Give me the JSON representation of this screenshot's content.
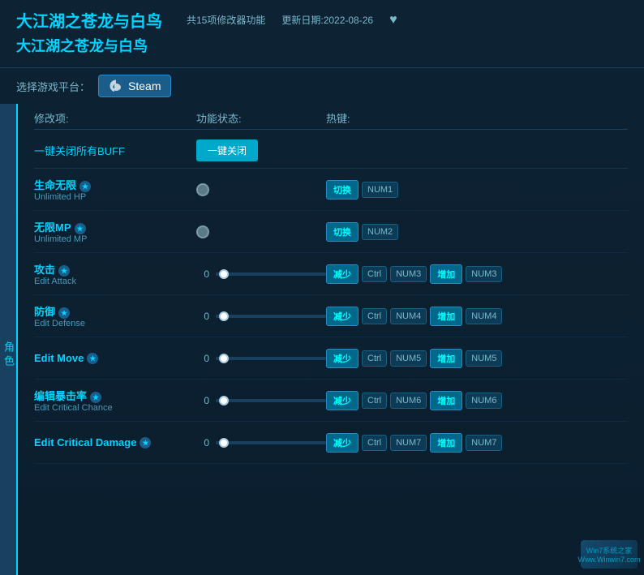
{
  "header": {
    "title_main": "大江湖之苍龙与白鸟",
    "title_sub": "大江湖之苍龙与白鸟",
    "meta_features": "共15项修改器功能",
    "meta_update": "更新日期:2022-08-26"
  },
  "platform": {
    "label": "选择游戏平台：",
    "steam_label": "Steam"
  },
  "columns": {
    "mod": "修改项:",
    "status": "功能状态:",
    "hotkey": "热键:"
  },
  "onekey": {
    "label": "一键关闭所有BUFF",
    "button": "一键关闭"
  },
  "side_tab": "角色",
  "modifiers": [
    {
      "name_zh": "生命无限",
      "name_en": "Unlimited HP",
      "type": "toggle",
      "value": null,
      "hotkeys": [
        {
          "type": "action",
          "label": "切换"
        },
        {
          "type": "key",
          "label": "NUM1"
        }
      ]
    },
    {
      "name_zh": "无限MP",
      "name_en": "Unlimited MP",
      "type": "toggle",
      "value": null,
      "hotkeys": [
        {
          "type": "action",
          "label": "切换"
        },
        {
          "type": "key",
          "label": "NUM2"
        }
      ]
    },
    {
      "name_zh": "攻击",
      "name_en": "Edit Attack",
      "type": "slider",
      "value": "0",
      "hotkeys": [
        {
          "type": "action",
          "label": "减少"
        },
        {
          "type": "key",
          "label": "Ctrl"
        },
        {
          "type": "key",
          "label": "NUM3"
        },
        {
          "type": "action",
          "label": "增加"
        },
        {
          "type": "key",
          "label": "NUM3"
        }
      ]
    },
    {
      "name_zh": "防御",
      "name_en": "Edit Defense",
      "type": "slider",
      "value": "0",
      "hotkeys": [
        {
          "type": "action",
          "label": "减少"
        },
        {
          "type": "key",
          "label": "Ctrl"
        },
        {
          "type": "key",
          "label": "NUM4"
        },
        {
          "type": "action",
          "label": "增加"
        },
        {
          "type": "key",
          "label": "NUM4"
        }
      ]
    },
    {
      "name_zh": "",
      "name_en": "Edit Move",
      "type": "slider",
      "value": "0",
      "hotkeys": [
        {
          "type": "action",
          "label": "减少"
        },
        {
          "type": "key",
          "label": "Ctrl"
        },
        {
          "type": "key",
          "label": "NUM5"
        },
        {
          "type": "action",
          "label": "增加"
        },
        {
          "type": "key",
          "label": "NUM5"
        }
      ]
    },
    {
      "name_zh": "编辑暴击率",
      "name_en": "Edit Critical Chance",
      "type": "slider",
      "value": "0",
      "hotkeys": [
        {
          "type": "action",
          "label": "减少"
        },
        {
          "type": "key",
          "label": "Ctrl"
        },
        {
          "type": "key",
          "label": "NUM6"
        },
        {
          "type": "action",
          "label": "增加"
        },
        {
          "type": "key",
          "label": "NUM6"
        }
      ]
    },
    {
      "name_zh": "",
      "name_en": "Edit Critical Damage",
      "type": "slider",
      "value": "0",
      "hotkeys": [
        {
          "type": "action",
          "label": "减少"
        },
        {
          "type": "key",
          "label": "Ctrl"
        },
        {
          "type": "key",
          "label": "NUM7"
        },
        {
          "type": "action",
          "label": "增加"
        },
        {
          "type": "key",
          "label": "NUM7"
        }
      ]
    }
  ],
  "watermark": {
    "line1": "Win7系统之家",
    "line2": "Www.Winwin7.com"
  }
}
